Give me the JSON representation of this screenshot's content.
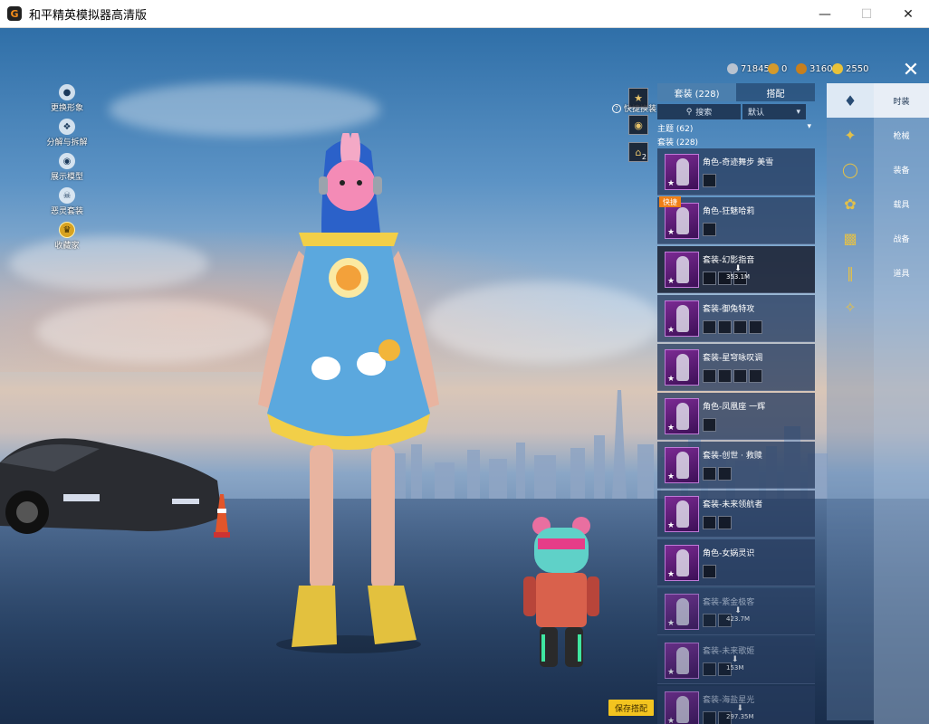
{
  "window": {
    "title": "和平精英模拟器高清版",
    "minimize_icon": "minimize-icon",
    "maximize_icon": "maximize-icon",
    "close_icon": "close-icon"
  },
  "left_menu": [
    {
      "label": "更换形象",
      "icon": "person-icon"
    },
    {
      "label": "分解与拆解",
      "icon": "puzzle-icon"
    },
    {
      "label": "展示模型",
      "icon": "eye-icon"
    },
    {
      "label": "恶灵套装",
      "icon": "skull-icon"
    },
    {
      "label": "收藏家",
      "icon": "collector-icon"
    }
  ],
  "quick_swap": {
    "label": "快捷换装",
    "slots": [
      {
        "icon": "outfit-slot-icon",
        "count": ""
      },
      {
        "icon": "helmet-slot-icon",
        "count": ""
      },
      {
        "icon": "hanger-slot-icon",
        "count": "2"
      }
    ]
  },
  "currency": [
    {
      "icon": "coin-silver-icon",
      "value": "71845",
      "color": "#b9c3d0"
    },
    {
      "icon": "coupon-icon",
      "value": "0",
      "color": "#d49a2b"
    },
    {
      "icon": "token-icon",
      "value": "3160",
      "color": "#c77f1d"
    },
    {
      "icon": "gold-coin-icon",
      "value": "2550",
      "color": "#e8c23a"
    }
  ],
  "panel": {
    "tabs": [
      "套装 (228)",
      "搭配"
    ],
    "active_tab": 0,
    "search_label": "搜索",
    "sort_label": "默认",
    "category_theme": "主题 (62)",
    "category_suit": "套装 (228)",
    "items": [
      {
        "name": "角色-奇迹舞步 美雪",
        "badge": "",
        "subs": 1,
        "state": "normal",
        "download": ""
      },
      {
        "name": "角色-狂魅哈莉",
        "badge": "快捷",
        "subs": 1,
        "state": "normal",
        "download": ""
      },
      {
        "name": "套装-幻影指音",
        "badge": "",
        "subs": 3,
        "state": "selected",
        "download": "353.1M"
      },
      {
        "name": "套装-御兔特攻",
        "badge": "",
        "subs": 4,
        "state": "normal",
        "download": ""
      },
      {
        "name": "套装-星穹咏叹调",
        "badge": "",
        "subs": 4,
        "state": "normal",
        "download": ""
      },
      {
        "name": "角色-凤凰座 一辉",
        "badge": "",
        "subs": 1,
        "state": "normal",
        "download": ""
      },
      {
        "name": "套装-创世 · 救赎",
        "badge": "",
        "subs": 2,
        "state": "normal",
        "download": ""
      },
      {
        "name": "套装-未来领航者",
        "badge": "",
        "subs": 2,
        "state": "normal",
        "download": ""
      },
      {
        "name": "角色-女娲灵识",
        "badge": "",
        "subs": 1,
        "state": "normal",
        "download": ""
      },
      {
        "name": "套装-紫金极客",
        "badge": "",
        "subs": 2,
        "state": "dim",
        "download": "423.7M"
      },
      {
        "name": "套装-未来歌姬",
        "badge": "",
        "subs": 2,
        "state": "dim",
        "download": "153M"
      },
      {
        "name": "套装-海盐星光",
        "badge": "",
        "subs": 2,
        "state": "dim",
        "download": "297.35M"
      }
    ]
  },
  "categories": [
    {
      "label": "时装",
      "icon": "fashion-icon"
    },
    {
      "label": "枪械",
      "icon": "gun-icon"
    },
    {
      "label": "装备",
      "icon": "goggles-icon"
    },
    {
      "label": "载具",
      "icon": "vehicle-icon"
    },
    {
      "label": "战备",
      "icon": "backpack-icon"
    },
    {
      "label": "道具",
      "icon": "pants-icon"
    },
    {
      "label": "",
      "icon": "axe-icon"
    }
  ],
  "active_category": 0,
  "save_button": "保存搭配",
  "close_game_icon": "close-x-icon"
}
